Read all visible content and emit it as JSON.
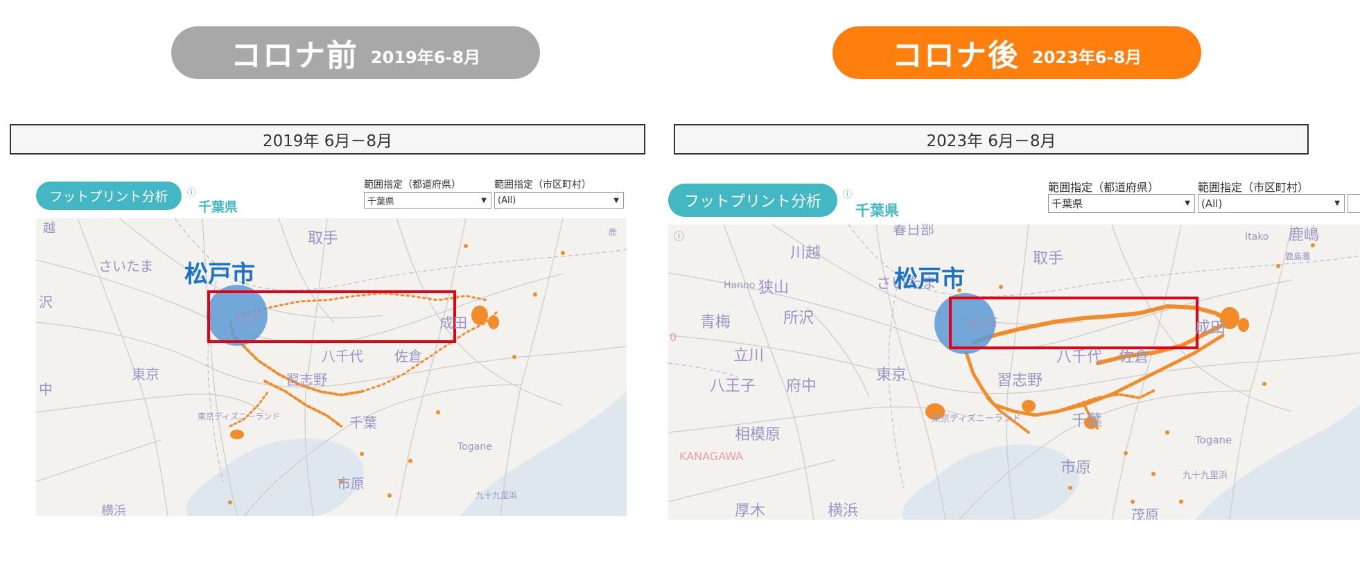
{
  "header": {
    "before": {
      "title": "コロナ前",
      "period": "2019年6-8月"
    },
    "after": {
      "title": "コロナ後",
      "period": "2023年6-8月"
    }
  },
  "colors": {
    "before_pill": "#a8a8a8",
    "after_pill": "#ff7f0e",
    "button_teal": "#43b8c4",
    "footprint_orange": "#f28c28",
    "highlight_red": "#e60012",
    "circle_blue": "#5b9bd5",
    "city_label_blue": "#1a73c8"
  },
  "left_panel": {
    "period_label": "2019年 6月－8月",
    "footprint_button": "フットプリント分析",
    "info_icon": "ⓘ",
    "prefecture": "千葉県",
    "filter_prefecture_label": "範囲指定（都道府県）",
    "filter_prefecture_value": "千葉県",
    "filter_city_label": "範囲指定（市区町村）",
    "filter_city_value": "(All)",
    "map": {
      "info_icon": "ⓘ",
      "highlight_label": "松戸市",
      "labels": [
        "取手",
        "さいたま",
        "松戸",
        "成田",
        "八千代",
        "佐倉",
        "東京",
        "習志野",
        "千葉",
        "東京ディズニーランド",
        "Togane",
        "市原",
        "九十九里浜",
        "越",
        "沢",
        "中",
        "横浜",
        "鹿"
      ]
    }
  },
  "right_panel": {
    "period_label": "2023年 6月－8月",
    "footprint_button": "フットプリント分析",
    "info_icon": "ⓘ",
    "prefecture": "千葉県",
    "filter_prefecture_label": "範囲指定（都道府県）",
    "filter_prefecture_value": "千葉県",
    "filter_city_label": "範囲指定（市区町村）",
    "filter_city_value": "(All)",
    "map": {
      "info_icon": "ⓘ",
      "highlight_label": "松戸市",
      "labels": [
        "春日部",
        "鹿嶋",
        "川越",
        "取手",
        "Itako",
        "鹿島灘",
        "Hanno",
        "狭山",
        "さいたま",
        "青梅",
        "所沢",
        "松戸",
        "成田",
        "立川",
        "八千代",
        "佐倉",
        "東京",
        "習志野",
        "八王子",
        "府中",
        "東京ディズニーランド",
        "千葉",
        "Togane",
        "相模原",
        "KANAGAWA",
        "市原",
        "九十九里浜",
        "厚木",
        "横浜",
        "茂原",
        "0"
      ]
    }
  }
}
